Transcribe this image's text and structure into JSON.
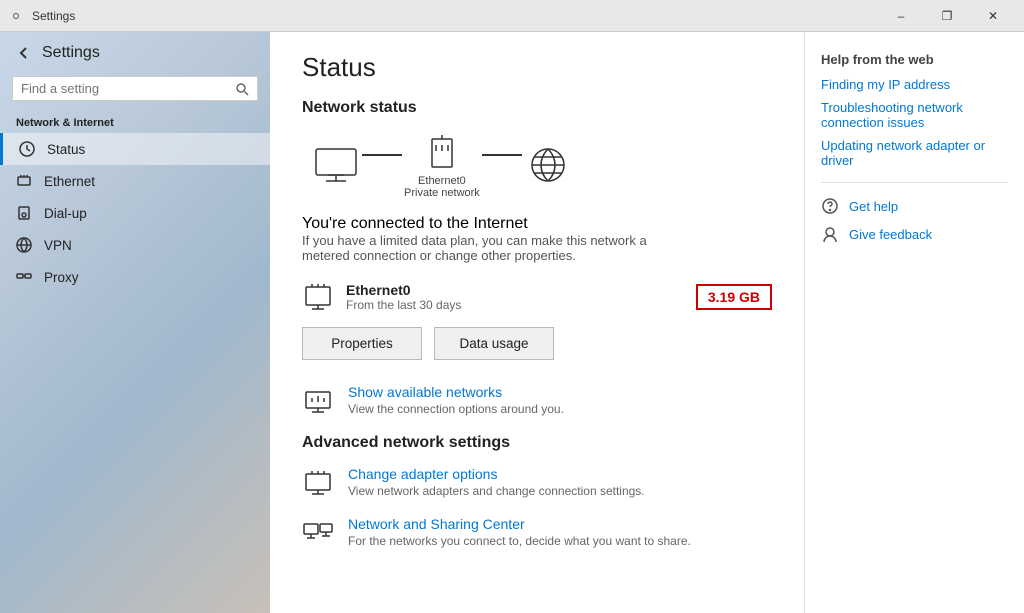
{
  "titlebar": {
    "title": "Settings",
    "btn_minimize": "–",
    "btn_restore": "❐",
    "btn_close": "✕"
  },
  "sidebar": {
    "back_icon": "←",
    "app_title": "Settings",
    "search_placeholder": "Find a setting",
    "section_title": "Network & Internet",
    "items": [
      {
        "id": "status",
        "label": "Status",
        "active": true
      },
      {
        "id": "ethernet",
        "label": "Ethernet",
        "active": false
      },
      {
        "id": "dialup",
        "label": "Dial-up",
        "active": false
      },
      {
        "id": "vpn",
        "label": "VPN",
        "active": false
      },
      {
        "id": "proxy",
        "label": "Proxy",
        "active": false
      }
    ]
  },
  "main": {
    "title": "Status",
    "network_status_title": "Network status",
    "diagram": {
      "adapter_label": "Ethernet0",
      "network_label": "Private network"
    },
    "connected_title": "You're connected to the Internet",
    "connected_desc": "If you have a limited data plan, you can make this network a metered connection or change other properties.",
    "eth_name": "Ethernet0",
    "eth_sub": "From the last 30 days",
    "data_usage": "3.19 GB",
    "btn_properties": "Properties",
    "btn_data_usage": "Data usage",
    "show_networks_title": "Show available networks",
    "show_networks_desc": "View the connection options around you.",
    "advanced_title": "Advanced network settings",
    "change_adapter_title": "Change adapter options",
    "change_adapter_desc": "View network adapters and change connection settings.",
    "sharing_center_title": "Network and Sharing Center",
    "sharing_center_desc": "For the networks you connect to, decide what you want to share."
  },
  "right_panel": {
    "help_title": "Help from the web",
    "links": [
      "Finding my IP address",
      "Troubleshooting network connection issues",
      "Updating network adapter or driver"
    ],
    "get_help_label": "Get help",
    "give_feedback_label": "Give feedback"
  }
}
